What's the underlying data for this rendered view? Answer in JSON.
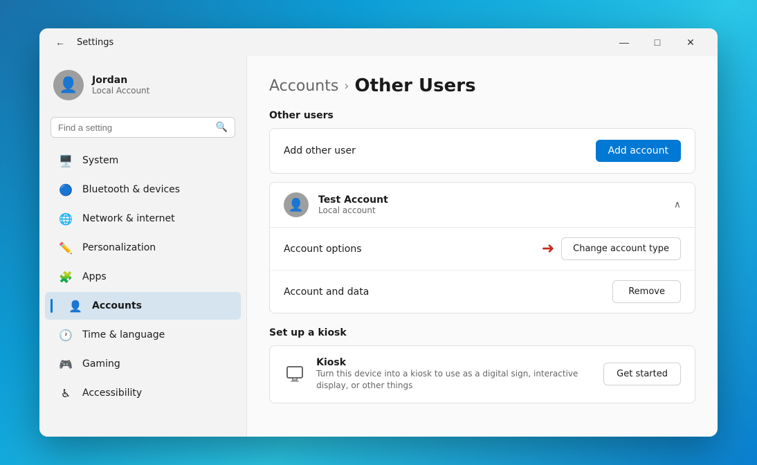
{
  "window": {
    "title": "Settings",
    "controls": {
      "minimize": "—",
      "maximize": "□",
      "close": "✕"
    }
  },
  "user_profile": {
    "name": "Jordan",
    "type": "Local Account"
  },
  "search": {
    "placeholder": "Find a setting"
  },
  "nav": {
    "items": [
      {
        "id": "system",
        "label": "System",
        "icon": "🖥️"
      },
      {
        "id": "bluetooth",
        "label": "Bluetooth & devices",
        "icon": "🔵"
      },
      {
        "id": "network",
        "label": "Network & internet",
        "icon": "🌐"
      },
      {
        "id": "personalization",
        "label": "Personalization",
        "icon": "✏️"
      },
      {
        "id": "apps",
        "label": "Apps",
        "icon": "🧩"
      },
      {
        "id": "accounts",
        "label": "Accounts",
        "icon": "👤",
        "active": true
      },
      {
        "id": "time",
        "label": "Time & language",
        "icon": "🕐"
      },
      {
        "id": "gaming",
        "label": "Gaming",
        "icon": "🎮"
      },
      {
        "id": "accessibility",
        "label": "Accessibility",
        "icon": "♿"
      }
    ]
  },
  "content": {
    "breadcrumb": {
      "parent": "Accounts",
      "separator": "›",
      "current": "Other Users"
    },
    "other_users_section": {
      "title": "Other users",
      "add_user_label": "Add other user",
      "add_account_btn": "Add account"
    },
    "test_account": {
      "name": "Test Account",
      "type": "Local account",
      "options_label": "Account options",
      "change_type_btn": "Change account type",
      "data_label": "Account and data",
      "remove_btn": "Remove"
    },
    "kiosk_section": {
      "title": "Set up a kiosk",
      "name": "Kiosk",
      "description": "Turn this device into a kiosk to use as a digital sign, interactive display, or other things",
      "get_started_btn": "Get started"
    }
  }
}
